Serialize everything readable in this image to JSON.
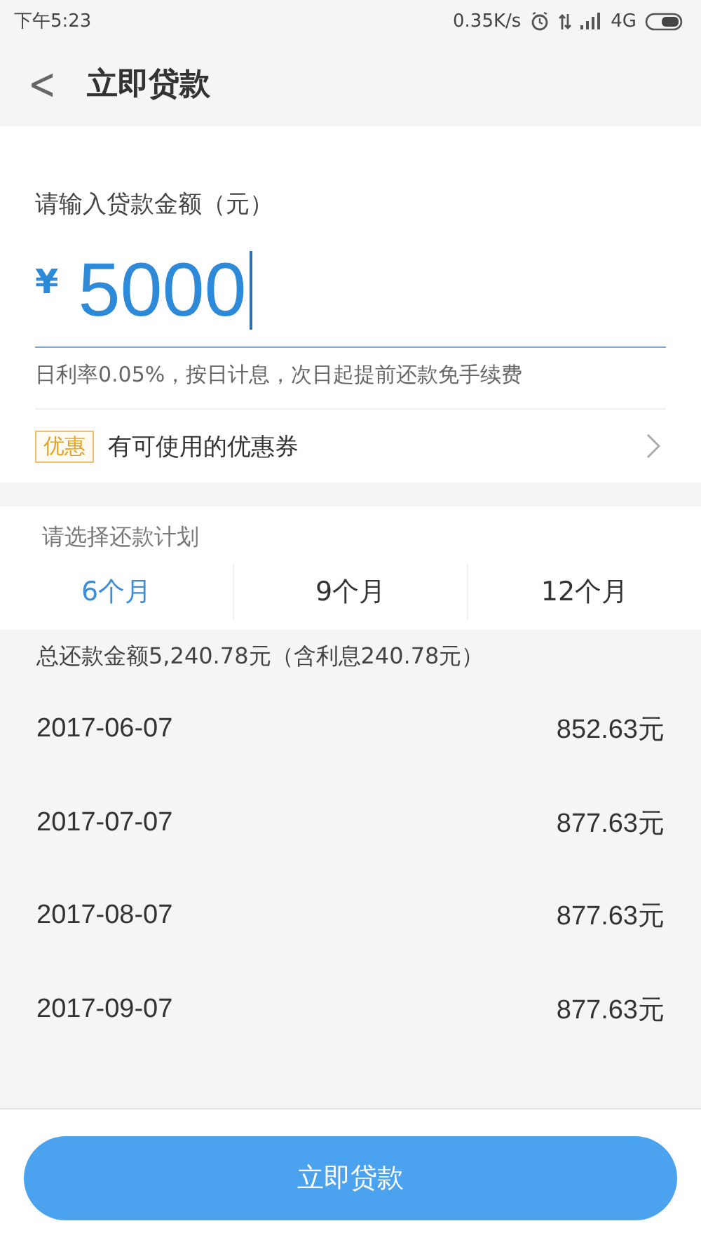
{
  "status_bar": {
    "time": "下午5:23",
    "speed": "0.35K/s",
    "network": "4G"
  },
  "header": {
    "back": "<",
    "title": "立即贷款"
  },
  "amount": {
    "label": "请输入贷款金额（元）",
    "currency": "¥",
    "value": "5000",
    "hint": "日利率0.05%，按日计息，次日起提前还款免手续费"
  },
  "coupon": {
    "tag": "优惠",
    "text": "有可使用的优惠券"
  },
  "plan": {
    "label": "请选择还款计划",
    "tabs": [
      {
        "label": "6个月",
        "selected": true
      },
      {
        "label": "9个月",
        "selected": false
      },
      {
        "label": "12个月",
        "selected": false
      }
    ],
    "summary": "总还款金额5,240.78元（含利息240.78元）",
    "rows": [
      {
        "date": "2017-06-07",
        "amount": "852.63元"
      },
      {
        "date": "2017-07-07",
        "amount": "877.63元"
      },
      {
        "date": "2017-08-07",
        "amount": "877.63元"
      },
      {
        "date": "2017-09-07",
        "amount": "877.63元"
      }
    ]
  },
  "submit": "立即贷款"
}
